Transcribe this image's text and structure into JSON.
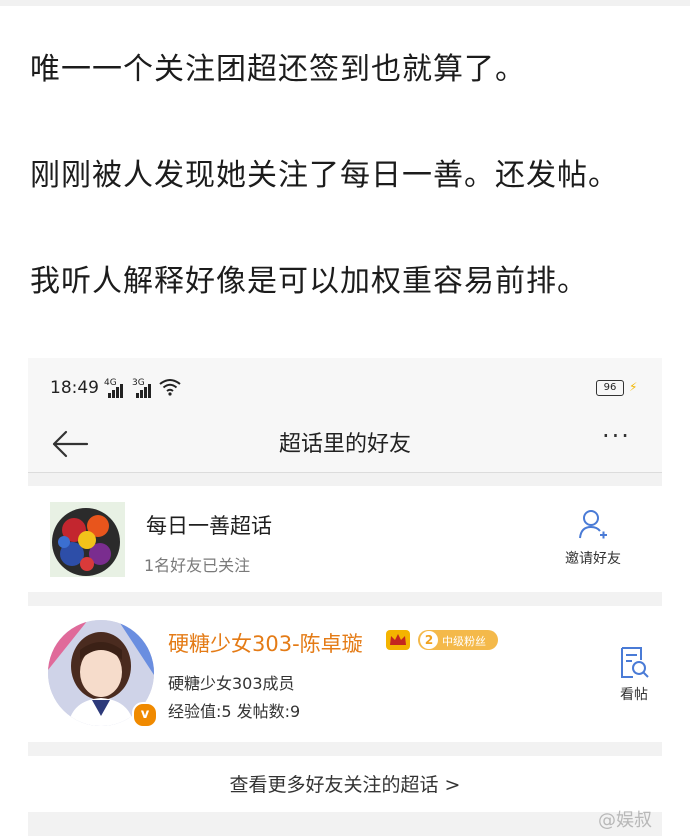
{
  "post": {
    "line1": "唯一一个关注团超还签到也就算了。",
    "line2": "刚刚被人发现她关注了每日一善。还发帖。",
    "line3": "我听人解释好像是可以加权重容易前排。"
  },
  "status_bar": {
    "time": "18:49",
    "net1": "4G",
    "net2": "3G",
    "battery": "96"
  },
  "nav": {
    "title": "超话里的好友",
    "more_label": "···"
  },
  "topic_card": {
    "title": "每日一善超话",
    "subtitle": "1名好友已关注",
    "invite_label": "邀请好友"
  },
  "friend_card": {
    "name": "硬糖少女303-陈卓璇",
    "fan_level": "2",
    "fan_badge": "中级粉丝",
    "role": "硬糖少女303成员",
    "stats": "经验值:5 发帖数:9",
    "view_label": "看帖",
    "verified_mark": "v"
  },
  "see_more": "查看更多好友关注的超话 >",
  "watermark": "@娱叔",
  "colors": {
    "accent_orange": "#e47b16",
    "badge_yellow": "#f4b94a",
    "bg_gray": "#f2f2f2"
  }
}
